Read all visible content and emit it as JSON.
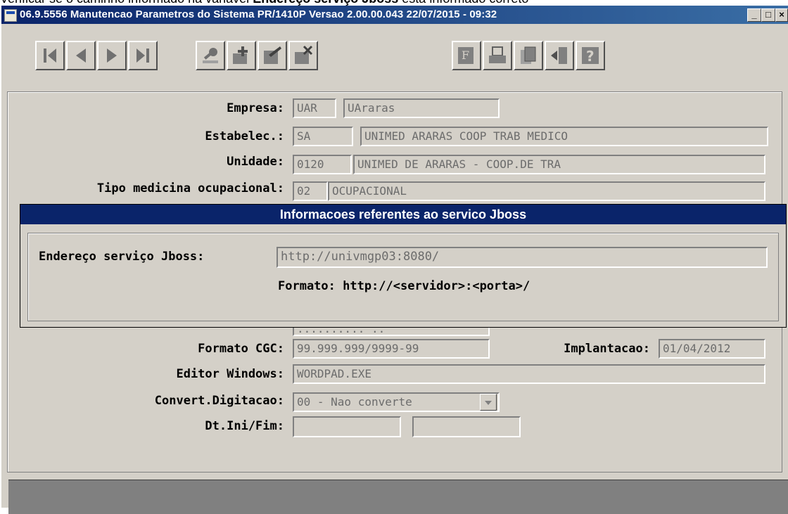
{
  "caption": {
    "prefix": "Verificar se o caminho informado na variável ",
    "variable": "Endereço serviço Jboss",
    "suffix": " está informado correto"
  },
  "window": {
    "title": "06.9.5556 Manutencao Parametros do Sistema PR/1410P Versao 2.00.00.043 22/07/2015 - 09:32",
    "minimize": "_",
    "restore": "□",
    "close": "×"
  },
  "toolbar": {
    "nav": [
      "first-icon",
      "previous-icon",
      "next-icon",
      "last-icon"
    ],
    "edit": [
      "search-icon",
      "add-icon",
      "edit-icon",
      "delete-icon"
    ],
    "tools": [
      "filter-icon",
      "print-icon",
      "copy-icon",
      "exit-icon",
      "help-icon"
    ]
  },
  "form": {
    "empresa": {
      "label": "Empresa:",
      "code": "UAR",
      "name": "UAraras"
    },
    "estabelec": {
      "label": "Estabelec.:",
      "code": "SA",
      "name": "UNIMED ARARAS COOP TRAB MEDICO"
    },
    "unidade": {
      "label": "Unidade:",
      "code": "0120",
      "name": "UNIMED DE ARARAS - COOP.DE TRA"
    },
    "tipo_medicina": {
      "label": "Tipo medicina ocupacional:",
      "code": "02",
      "name": "OCUPACIONAL"
    },
    "partial_field": ".......... ..",
    "formato_cgc": {
      "label": "Formato CGC:",
      "value": "99.999.999/9999-99"
    },
    "implantacao": {
      "label": "Implantacao:",
      "value": "01/04/2012"
    },
    "editor_windows": {
      "label": "Editor Windows:",
      "value": "WORDPAD.EXE"
    },
    "convert_digitacao": {
      "label": "Convert.Digitacao:",
      "value": "00 - Nao converte"
    },
    "dt_ini_fim": {
      "label": "Dt.Ini/Fim:",
      "ini": "",
      "fim": ""
    }
  },
  "dialog": {
    "title": "Informacoes referentes ao servico Jboss",
    "label": "Endereço serviço Jboss:",
    "value": "http://univmgp03:8080/",
    "hint": "Formato: http://<servidor>:<porta>/"
  },
  "colors": {
    "titlebar": "#0a246a",
    "face": "#d4d0c8",
    "status": "#808080"
  }
}
